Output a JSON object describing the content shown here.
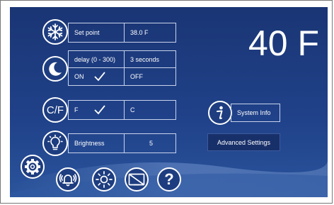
{
  "temperature": "40 F",
  "setpoint": {
    "label": "Set point",
    "value": "38.0 F"
  },
  "delay": {
    "label": "delay (0 - 300)",
    "value": "3 seconds",
    "on_label": "ON",
    "off_label": "OFF",
    "selected": "on"
  },
  "units": {
    "f_label": "F",
    "c_label": "C",
    "selected": "F"
  },
  "brightness": {
    "label": "Brightness",
    "value": "5"
  },
  "system_info": {
    "label": "System Info"
  },
  "advanced_settings": {
    "label": "Advanced Settings"
  },
  "icons": {
    "setpoint": "snowflake-icon",
    "delay": "moon-icon",
    "units": "cf-icon",
    "brightness": "lightbulb-icon",
    "settings": "gear-icon",
    "alarm": "alarm-bell-icon",
    "display": "sun-icon",
    "screen": "screen-icon",
    "help": "question-icon",
    "info": "info-icon"
  },
  "units_icon_text": "C/F",
  "help_icon_text": "?",
  "colors": {
    "background": "#1e3d80",
    "text": "#ffffff",
    "button": "#18306a"
  }
}
